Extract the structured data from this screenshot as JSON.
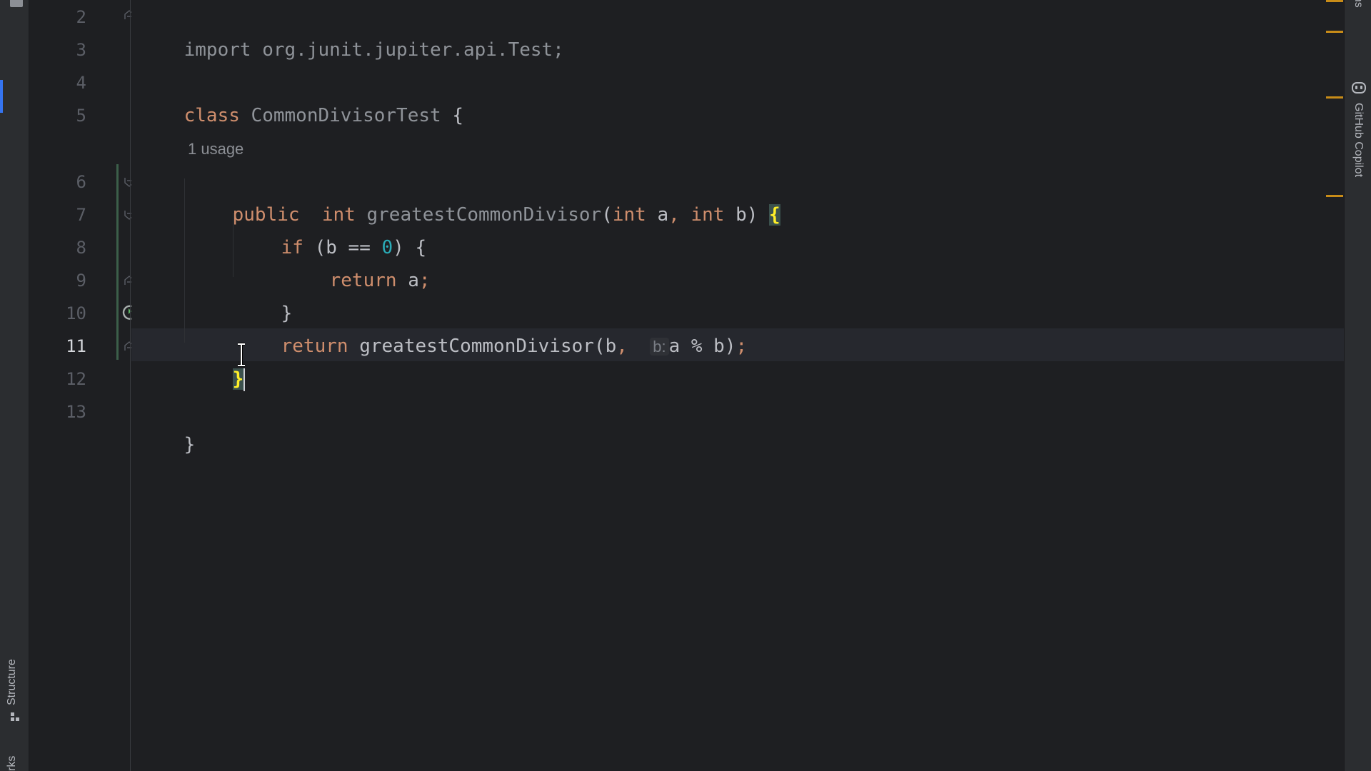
{
  "left_toolbar": {
    "structure_label": "Structure",
    "bookmarks_label": "rks"
  },
  "right_toolbar": {
    "notifications_label": "cations",
    "copilot_label": "GitHub Copilot"
  },
  "gutter": {
    "line_numbers": [
      "2",
      "3",
      "4",
      "5",
      "6",
      "7",
      "8",
      "9",
      "10",
      "11",
      "12",
      "13"
    ],
    "current_line": "11"
  },
  "editor": {
    "usage_hint": "1 usage",
    "param_hint": "b:",
    "lines": {
      "l2": {
        "kw": "import",
        "rest": " org.junit.jupiter.api.Test;"
      },
      "l4": {
        "kw": "class",
        "name": " CommonDivisorTest",
        "brace": " {"
      },
      "l6": {
        "kw1": "public",
        "kw2": "  int",
        "name": " greatestCommonDivisor",
        "p1": "(",
        "kw3": "int",
        "a": " a",
        "comma": ",",
        "kw4": " int",
        "b": " b)",
        "brace": "{"
      },
      "l7": {
        "kw": "if",
        "cond1": " (b == ",
        "zero": "0",
        "cond2": ") {"
      },
      "l8": {
        "kw": "return",
        "rest": " a",
        "semi": ";"
      },
      "l9": {
        "brace": "}"
      },
      "l10": {
        "kw": "return",
        "call": " greatestCommonDivisor(b",
        "comma": ",",
        "expr": "a % b)",
        "semi": ";"
      },
      "l11": {
        "brace": "}"
      },
      "l13": {
        "brace": "}"
      }
    }
  },
  "colors": {
    "background": "#1e1f22",
    "keyword": "#cf8e6d",
    "number": "#2aacb8",
    "brace_highlight": "#ffef28",
    "scroll_marker": "#c88c18"
  }
}
